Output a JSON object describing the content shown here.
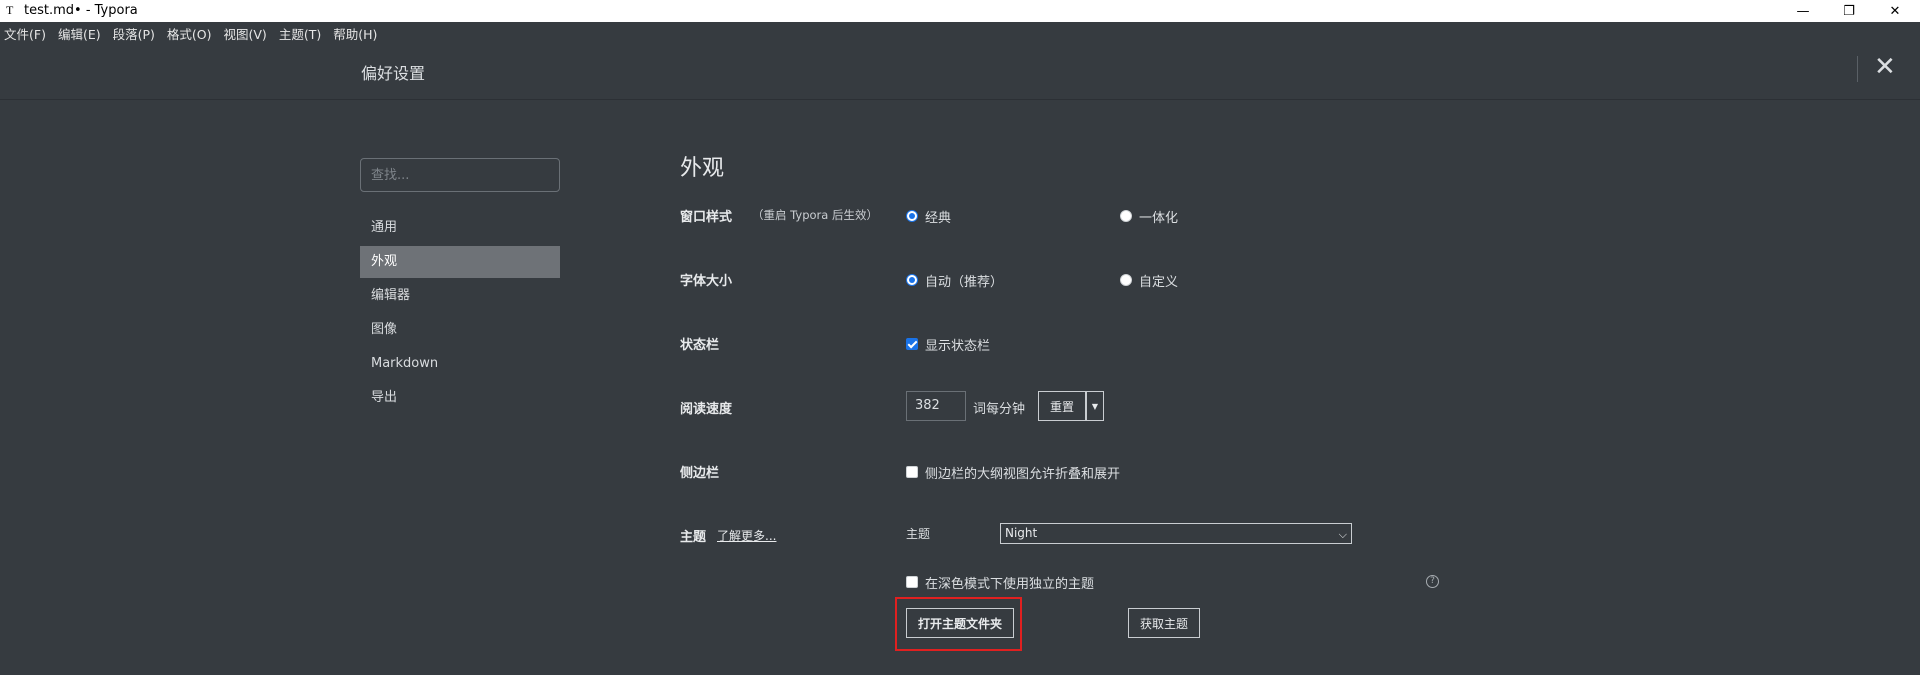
{
  "window": {
    "app_icon": "T",
    "title": "test.md• - Typora",
    "minimize": "—",
    "maximize": "❐",
    "close": "✕"
  },
  "menu": [
    "文件(F)",
    "编辑(E)",
    "段落(P)",
    "格式(O)",
    "视图(V)",
    "主题(T)",
    "帮助(H)"
  ],
  "prefs": {
    "title": "偏好设置",
    "close": "✕",
    "search_placeholder": "查找...",
    "nav": [
      "通用",
      "外观",
      "编辑器",
      "图像",
      "Markdown",
      "导出"
    ],
    "active_nav": "外观"
  },
  "appearance": {
    "title": "外观",
    "window_style": {
      "label": "窗口样式",
      "note": "（重启 Typora 后生效）",
      "opt1": "经典",
      "opt2": "一体化",
      "selected": "经典"
    },
    "font_size": {
      "label": "字体大小",
      "opt1": "自动（推荐）",
      "opt2": "自定义",
      "selected": "自动（推荐）"
    },
    "status_bar": {
      "label": "状态栏",
      "checkbox": "显示状态栏",
      "checked": true
    },
    "reading_speed": {
      "label": "阅读速度",
      "value": "382",
      "unit": "词每分钟",
      "reset": "重置",
      "caret": "▼"
    },
    "sidebar": {
      "label": "侧边栏",
      "checkbox": "侧边栏的大纲视图允许折叠和展开",
      "checked": false
    },
    "theme": {
      "label": "主题",
      "learn_more": "了解更多...",
      "sub_label": "主题",
      "selected": "Night",
      "caret": "⌵",
      "dark_checkbox": "在深色模式下使用独立的主题",
      "dark_checked": false,
      "open_folder": "打开主题文件夹",
      "get_themes": "获取主题",
      "help": "?"
    }
  },
  "colors": {
    "background": "#363b40",
    "accent": "#1a73e8",
    "highlight": "#e02020"
  }
}
